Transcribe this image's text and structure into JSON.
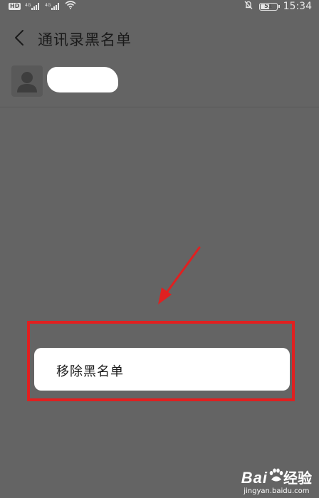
{
  "status_bar": {
    "hd_label": "HD",
    "network_left": "4G",
    "network_right": "4G",
    "battery": "51",
    "time": "15:34",
    "icons": [
      "hd-icon",
      "signal-icon",
      "signal-icon",
      "wifi-icon",
      "mute-bell-icon",
      "battery-icon"
    ]
  },
  "header": {
    "back_icon": "chevron-left-icon",
    "title": "通讯录黑名单"
  },
  "contact": {
    "avatar_icon": "person-icon"
  },
  "menu": {
    "remove_label": "移除黑名单"
  },
  "colors": {
    "overlay_bg": "#646464",
    "highlight": "#e02020",
    "popup_bg": "#ffffff"
  },
  "watermark": {
    "brand": "Bai",
    "brand_suffix": "经验",
    "url": "jingyan.baidu.com"
  }
}
